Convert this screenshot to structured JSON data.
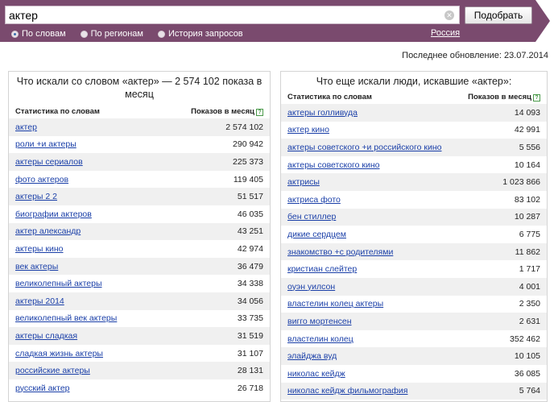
{
  "search": {
    "value": "актер",
    "button_label": "Подобрать"
  },
  "filters": [
    {
      "label": "По словам",
      "selected": true
    },
    {
      "label": "По регионам",
      "selected": false
    },
    {
      "label": "История запросов",
      "selected": false
    }
  ],
  "region": "Россия",
  "last_update": "Последнее обновление: 23.07.2014",
  "colors": {
    "header_bg": "#7a4a6e",
    "link": "#1a3fa8",
    "row_stripe": "#f0f0f0"
  },
  "left": {
    "title": "Что искали со словом «актер» — 2 574 102 показа в месяц",
    "col_keyword": "Статистика по словам",
    "col_shows": "Показов в месяц",
    "rows": [
      {
        "kw": "актер",
        "num": "2 574 102"
      },
      {
        "kw": "роли +и актеры",
        "num": "290 942"
      },
      {
        "kw": "актеры сериалов",
        "num": "225 373"
      },
      {
        "kw": "фото актеров",
        "num": "119 405"
      },
      {
        "kw": "актеры 2 2",
        "num": "51 517"
      },
      {
        "kw": "биографии актеров",
        "num": "46 035"
      },
      {
        "kw": "актер александр",
        "num": "43 251"
      },
      {
        "kw": "актеры кино",
        "num": "42 974"
      },
      {
        "kw": "век актеры",
        "num": "36 479"
      },
      {
        "kw": "великолепный актеры",
        "num": "34 338"
      },
      {
        "kw": "актеры 2014",
        "num": "34 056"
      },
      {
        "kw": "великолепный век актеры",
        "num": "33 735"
      },
      {
        "kw": "актеры сладкая",
        "num": "31 519"
      },
      {
        "kw": "сладкая жизнь актеры",
        "num": "31 107"
      },
      {
        "kw": "российские актеры",
        "num": "28 131"
      },
      {
        "kw": "русский актер",
        "num": "26 718"
      }
    ]
  },
  "right": {
    "title": "Что еще искали люди, искавшие «актер»:",
    "col_keyword": "Статистика по словам",
    "col_shows": "Показов в месяц",
    "rows": [
      {
        "kw": "актеры голливуда",
        "num": "14 093"
      },
      {
        "kw": "актер кино",
        "num": "42 991"
      },
      {
        "kw": "актеры советского +и российского кино",
        "num": "5 556"
      },
      {
        "kw": "актеры советского кино",
        "num": "10 164"
      },
      {
        "kw": "актрисы",
        "num": "1 023 866"
      },
      {
        "kw": "актриса фото",
        "num": "83 102"
      },
      {
        "kw": "бен стиллер",
        "num": "10 287"
      },
      {
        "kw": "дикие сердцем",
        "num": "6 775"
      },
      {
        "kw": "знакомство +с родителями",
        "num": "11 862"
      },
      {
        "kw": "кристиан слейтер",
        "num": "1 717"
      },
      {
        "kw": "оуэн уилсон",
        "num": "4 001"
      },
      {
        "kw": "властелин колец актеры",
        "num": "2 350"
      },
      {
        "kw": "вигго мортенсен",
        "num": "2 631"
      },
      {
        "kw": "властелин колец",
        "num": "352 462"
      },
      {
        "kw": "элайджа вуд",
        "num": "10 105"
      },
      {
        "kw": "николас кейдж",
        "num": "36 085"
      },
      {
        "kw": "николас кейдж фильмография",
        "num": "5 764"
      }
    ]
  }
}
